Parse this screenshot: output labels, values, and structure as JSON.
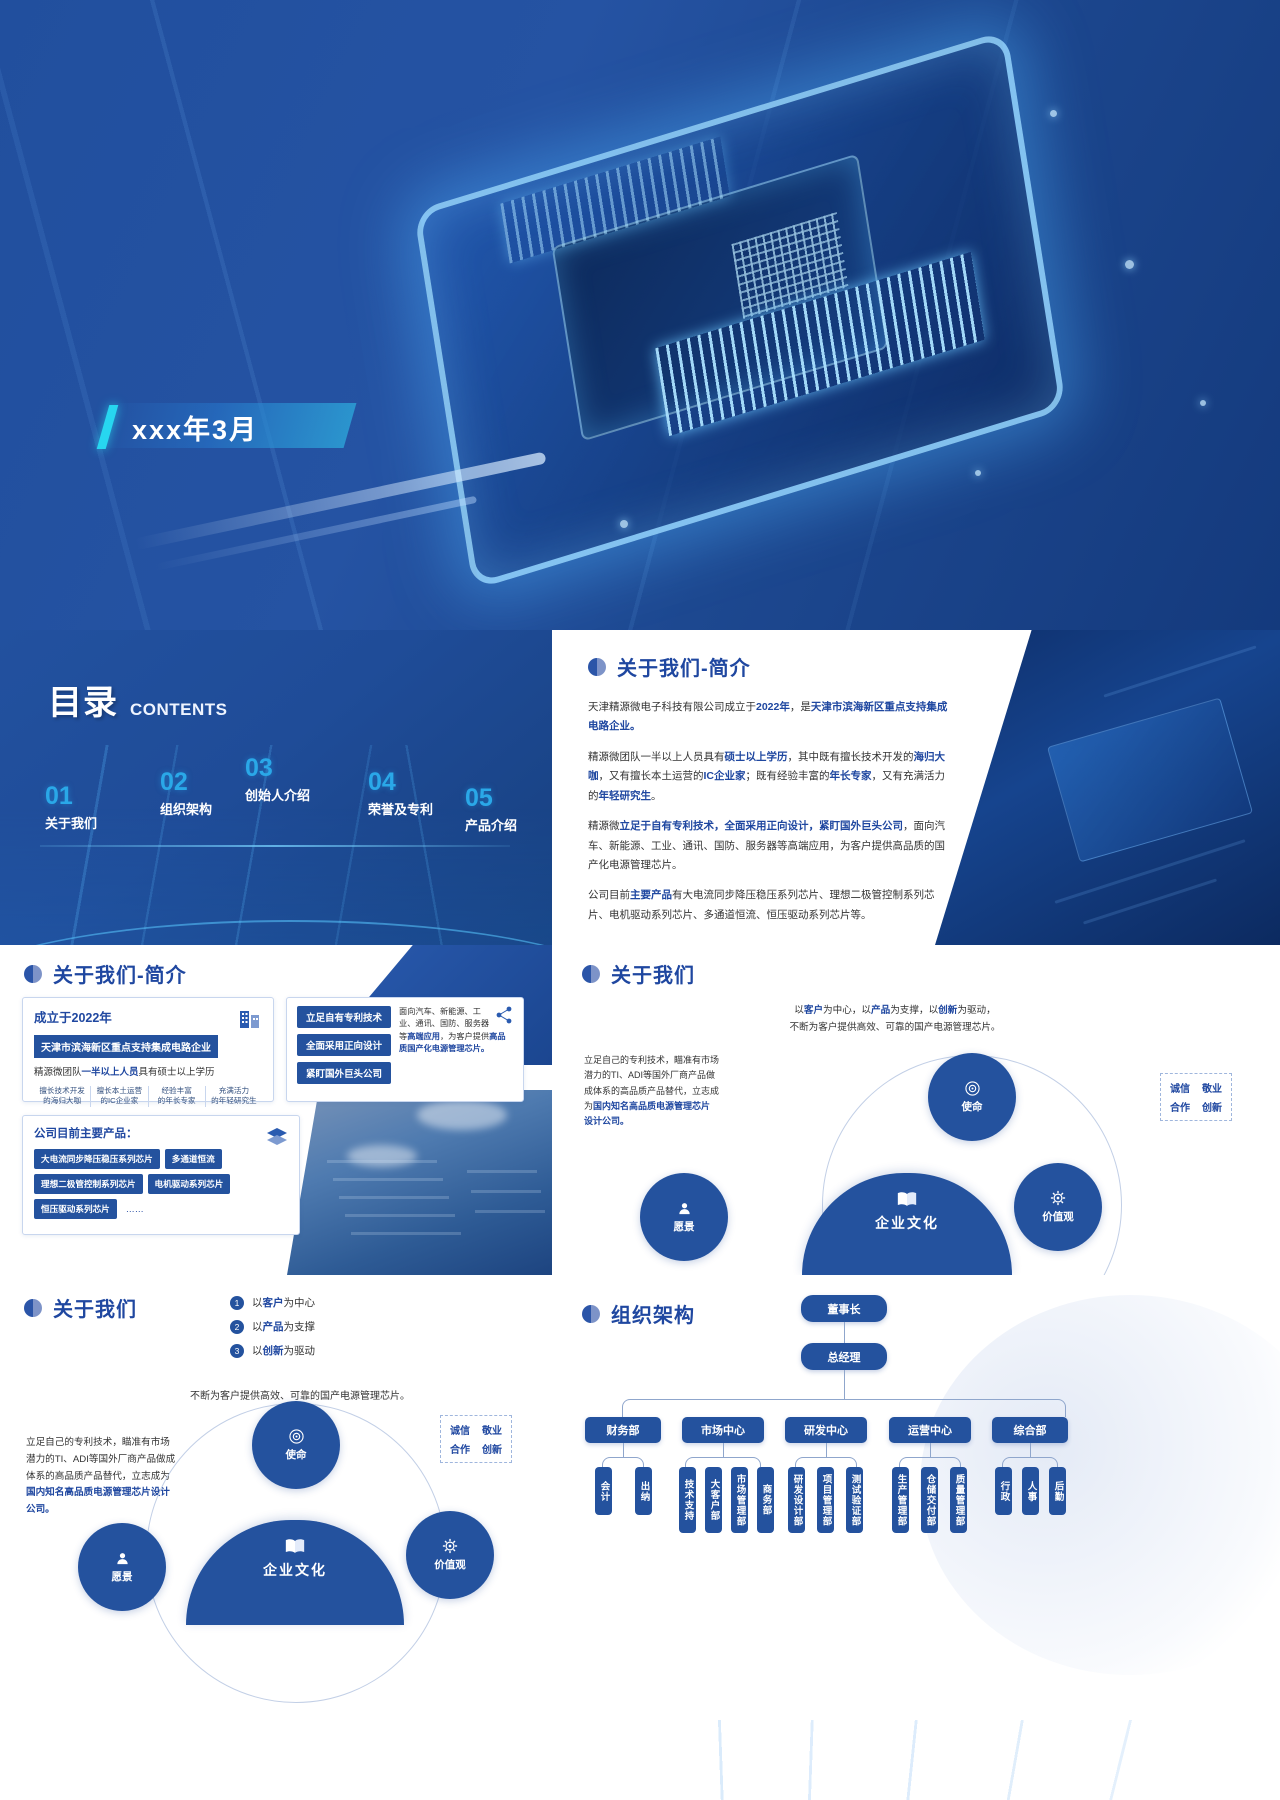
{
  "cover": {
    "title": "xxx年3月",
    "accent_color": "#27d6f0",
    "brand_blue": "#24529e"
  },
  "toc": {
    "title_cn": "目录",
    "title_en": "CONTENTS",
    "items": [
      {
        "num": "01",
        "label": "关于我们"
      },
      {
        "num": "02",
        "label": "组织架构"
      },
      {
        "num": "03",
        "label": "创始人介绍"
      },
      {
        "num": "04",
        "label": "荣誉及专利"
      },
      {
        "num": "05",
        "label": "产品介绍"
      }
    ]
  },
  "about_intro": {
    "section_title": "关于我们-简介",
    "paragraphs": [
      "天津精源微电子科技有限公司成立于2022年，是天津市滨海新区重点支持集成电路企业。",
      "精源微团队一半以上人员具有硕士以上学历，其中既有擅长技术开发的海归大咖，又有擅长本土运营的IC企业家；既有经验丰富的年长专家，又有充满活力的年轻研究生。",
      "精源微立足于自有专利技术，全面采用正向设计，紧盯国外巨头公司，面向汽车、新能源、工业、通讯、国防、服务器等高端应用，为客户提供高品质的国产化电源管理芯片。",
      "公司目前主要产品有大电流同步降压稳压系列芯片、理想二极管控制系列芯片、电机驱动系列芯片、多通道恒流、恒压驱动系列芯片等。"
    ]
  },
  "about_cards": {
    "section_title": "关于我们-简介",
    "founded_year": "成立于2022年",
    "highlight": "天津市滨海新区重点支持集成电路企业",
    "team_line": "精源微团队一半以上人员具有硕士以上学历",
    "team_quads": [
      "擅长技术开发的海归大咖",
      "擅长本土运营的IC企业家",
      "经验丰富的年长专家",
      "充满活力的年轻研究生"
    ],
    "tech_pills": [
      "立足自有专利技术",
      "全面采用正向设计",
      "紧盯国外巨头公司"
    ],
    "application_text": "面向汽车、新能源、工业、通讯、国防、服务器等高端应用，为客户提供高品质国产化电源管理芯片。",
    "products_title": "公司目前主要产品：",
    "product_pills": [
      "大电流同步降压稳压系列芯片",
      "多通道恒流",
      "理想二极管控制系列芯片",
      "电机驱动系列芯片",
      "恒压驱动系列芯片",
      "……"
    ]
  },
  "culture": {
    "section_title": "关于我们",
    "intro": "以客户为中心，以产品为支撑，以创新为驱动，不断为客户提供高效、可靠的国产电源管理芯片。",
    "description": "立足自己的专利技术，瞄准有市场潜力的TI、ADI等国外厂商产品做成体系的高品质产品替代，立志成为国内知名高品质电源管理芯片设计公司。",
    "center": {
      "icon": "book-icon",
      "label": "企业文化"
    },
    "nodes": [
      {
        "icon": "target-icon",
        "label": "使命"
      },
      {
        "icon": "person-icon",
        "label": "愿景"
      },
      {
        "icon": "gear-icon",
        "label": "价值观"
      }
    ],
    "values": [
      "诚信",
      "敬业",
      "合作",
      "创新"
    ]
  },
  "culture_alt": {
    "section_title": "关于我们",
    "numbered": [
      {
        "n": "1",
        "text": "以客户为中心"
      },
      {
        "n": "2",
        "text": "以产品为支撑"
      },
      {
        "n": "3",
        "text": "以创新为驱动"
      }
    ],
    "tagline": "不断为客户提供高效、可靠的国产电源管理芯片。",
    "description": "立足自己的专利技术，瞄准有市场潜力的TI、ADI等国外厂商产品做成体系的高品质产品替代，立志成为国内知名高品质电源管理芯片设计公司。",
    "center": {
      "icon": "book-icon",
      "label": "企业文化"
    },
    "nodes": [
      {
        "icon": "target-icon",
        "label": "使命"
      },
      {
        "icon": "person-icon",
        "label": "愿景"
      },
      {
        "icon": "gear-icon",
        "label": "价值观"
      }
    ],
    "values": [
      "诚信",
      "敬业",
      "合作",
      "创新"
    ]
  },
  "org": {
    "section_title": "组织架构",
    "top": [
      "董事长",
      "总经理"
    ],
    "departments": [
      {
        "name": "财务部",
        "children": [
          "会计",
          "出纳"
        ]
      },
      {
        "name": "市场中心",
        "children": [
          "技术支持",
          "大客户部",
          "市场管理部",
          "商务部"
        ]
      },
      {
        "name": "研发中心",
        "children": [
          "研发设计部",
          "项目管理部",
          "测试验证部"
        ]
      },
      {
        "name": "运营中心",
        "children": [
          "生产管理部",
          "仓储交付部",
          "质量管理部"
        ]
      },
      {
        "name": "综合部",
        "children": [
          "行政",
          "人事",
          "后勤"
        ]
      }
    ]
  }
}
